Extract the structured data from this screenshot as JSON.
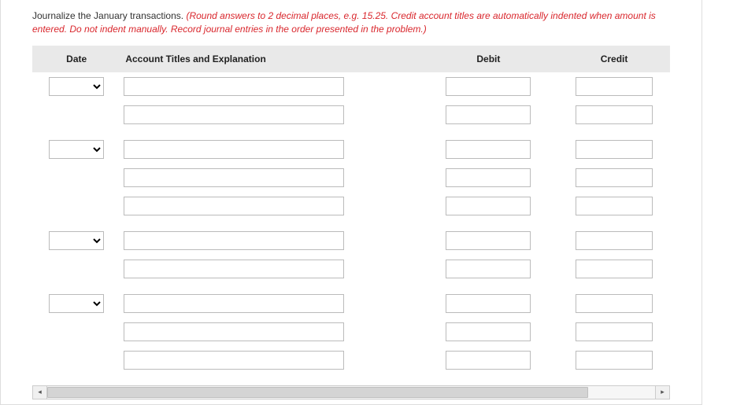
{
  "instructions": {
    "lead": "Journalize the January transactions. ",
    "red": "(Round answers to 2 decimal places, e.g. 15.25. Credit account titles are automatically indented when amount is entered. Do not indent manually. Record journal entries in the order presented in the problem.)"
  },
  "headers": {
    "date": "Date",
    "acct": "Account Titles and Explanation",
    "debit": "Debit",
    "credit": "Credit"
  },
  "rows": [
    {
      "showDate": true
    },
    {
      "showDate": false
    },
    {
      "spacer": true
    },
    {
      "showDate": true
    },
    {
      "showDate": false
    },
    {
      "showDate": false
    },
    {
      "spacer": true
    },
    {
      "showDate": true
    },
    {
      "showDate": false
    },
    {
      "spacer": true
    },
    {
      "showDate": true
    },
    {
      "showDate": false
    },
    {
      "showDate": false
    }
  ]
}
